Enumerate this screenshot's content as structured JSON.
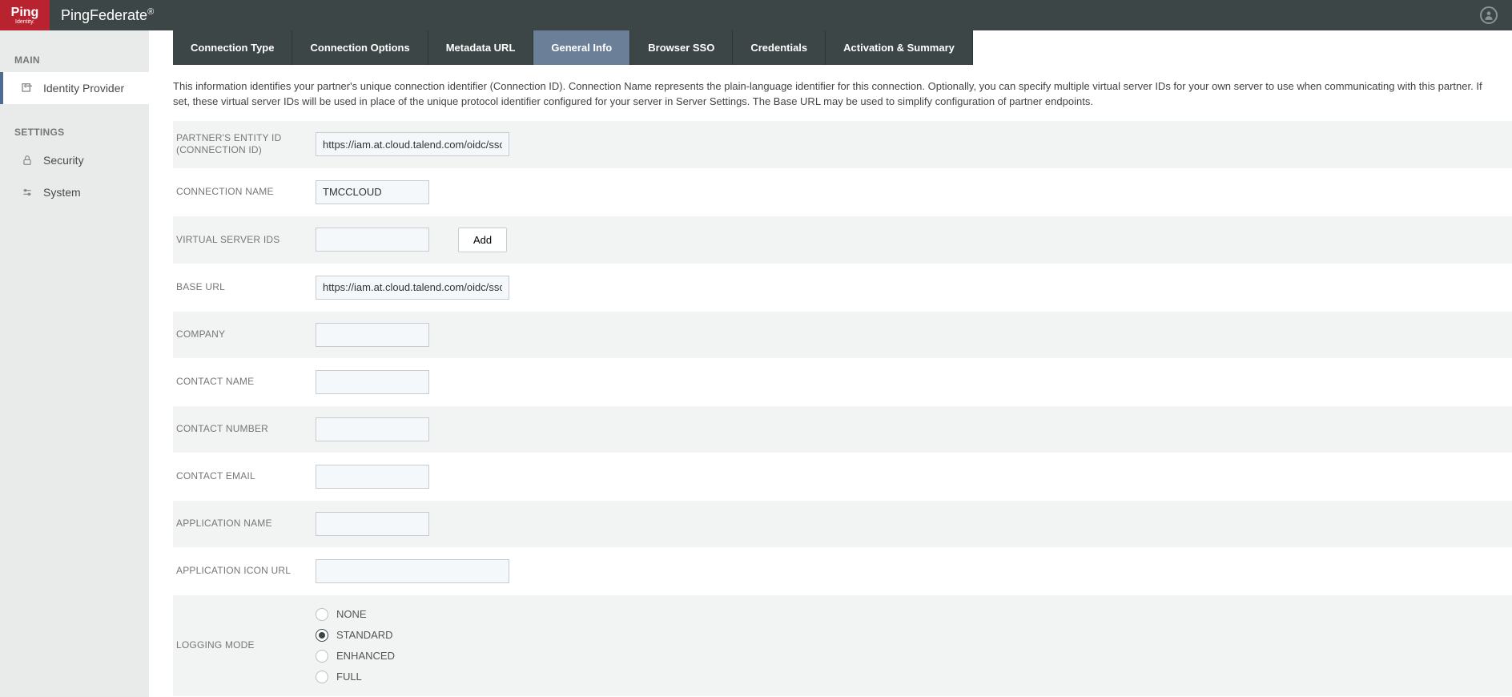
{
  "header": {
    "logo_text": "Ping",
    "logo_sub": "Identity.",
    "product": "PingFederate"
  },
  "sidebar": {
    "section_main": "MAIN",
    "item_idp": "Identity Provider",
    "section_settings": "SETTINGS",
    "item_security": "Security",
    "item_system": "System"
  },
  "tabs": {
    "connection_type": "Connection Type",
    "connection_options": "Connection Options",
    "metadata_url": "Metadata URL",
    "general_info": "General Info",
    "browser_sso": "Browser SSO",
    "credentials": "Credentials",
    "activation_summary": "Activation & Summary"
  },
  "intro": "This information identifies your partner's unique connection identifier (Connection ID). Connection Name represents the plain-language identifier for this connection. Optionally, you can specify multiple virtual server IDs for your own server to use when communicating with this partner. If set, these virtual server IDs will be used in place of the unique protocol identifier configured for your server in Server Settings. The Base URL may be used to simplify configuration of partner endpoints.",
  "form": {
    "entity_id_label": "PARTNER'S ENTITY ID (CONNECTION ID)",
    "entity_id_value": "https://iam.at.cloud.talend.com/oidc/ssologin",
    "connection_name_label": "CONNECTION NAME",
    "connection_name_value": "TMCCLOUD",
    "virtual_server_ids_label": "VIRTUAL SERVER IDS",
    "virtual_server_ids_value": "",
    "add_button": "Add",
    "base_url_label": "BASE URL",
    "base_url_value": "https://iam.at.cloud.talend.com/oidc/ssologin",
    "company_label": "COMPANY",
    "company_value": "",
    "contact_name_label": "CONTACT NAME",
    "contact_name_value": "",
    "contact_number_label": "CONTACT NUMBER",
    "contact_number_value": "",
    "contact_email_label": "CONTACT EMAIL",
    "contact_email_value": "",
    "application_name_label": "APPLICATION NAME",
    "application_name_value": "",
    "application_icon_url_label": "APPLICATION ICON URL",
    "application_icon_url_value": "",
    "logging_mode_label": "LOGGING MODE",
    "logging_options": {
      "none": "NONE",
      "standard": "STANDARD",
      "enhanced": "ENHANCED",
      "full": "FULL"
    },
    "logging_selected": "standard"
  }
}
